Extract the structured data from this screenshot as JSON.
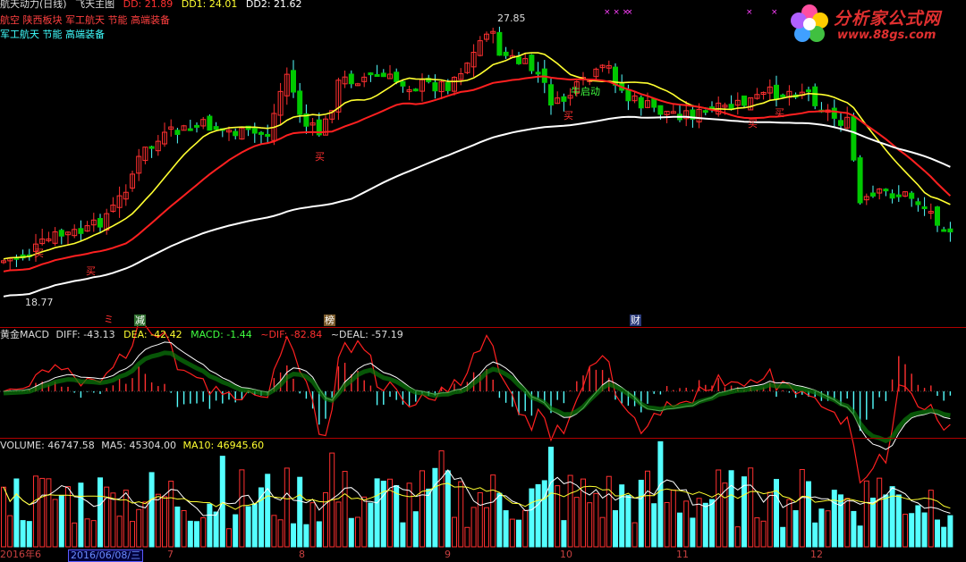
{
  "main_panel": {
    "title": "航天动力(日线)",
    "indicator_name": "飞天主图",
    "dd_label": "DD: 21.89",
    "dd1_label": "DD1: 24.01",
    "dd2_label": "DD2: 21.62",
    "sector_line1": "航空 陕西板块 军工航天 节能 高端装备",
    "sector_line2": "军工航天 节能 高端装备",
    "high_marker": "27.85",
    "low_marker": "18.77",
    "signal_buy": "买",
    "signal_bull": "牛启动",
    "top_marks": "× × ×",
    "top_mark_single": "×"
  },
  "event_badges": [
    {
      "text": "减",
      "color": "#ffffff",
      "bg": "#2f6f2f"
    },
    {
      "text": "榜",
      "color": "#ffffff",
      "bg": "#7a5a2a"
    },
    {
      "text": "财",
      "color": "#ffffff",
      "bg": "#2a3a7a"
    }
  ],
  "event_glyph": "ミ",
  "macd_panel": {
    "name": "黄金MACD",
    "diff": "DIFF: -43.13",
    "dea": "DEA: -42.42",
    "macd": "MACD: -1.44",
    "dif2": "~DIF: -82.84",
    "deal": "~DEAL: -57.19"
  },
  "volume_panel": {
    "volume": "VOLUME: 46747.58",
    "ma5": "MA5: 45304.00",
    "ma10": "MA10: 46945.60"
  },
  "x_axis": {
    "start_label": "2016年6",
    "cursor_date": "2016/06/08/三",
    "months": [
      "7",
      "8",
      "9",
      "10",
      "11",
      "12"
    ]
  },
  "logo": {
    "name": "分析家公式网",
    "url": "www.88gs.com"
  },
  "colors": {
    "up": "#ff3030",
    "down": "#54ffff",
    "down_fill": "#00c800",
    "ma_yellow": "#ffff30",
    "ma_red": "#ff2020",
    "ma_white": "#ffffff",
    "separator": "#b00000"
  }
}
